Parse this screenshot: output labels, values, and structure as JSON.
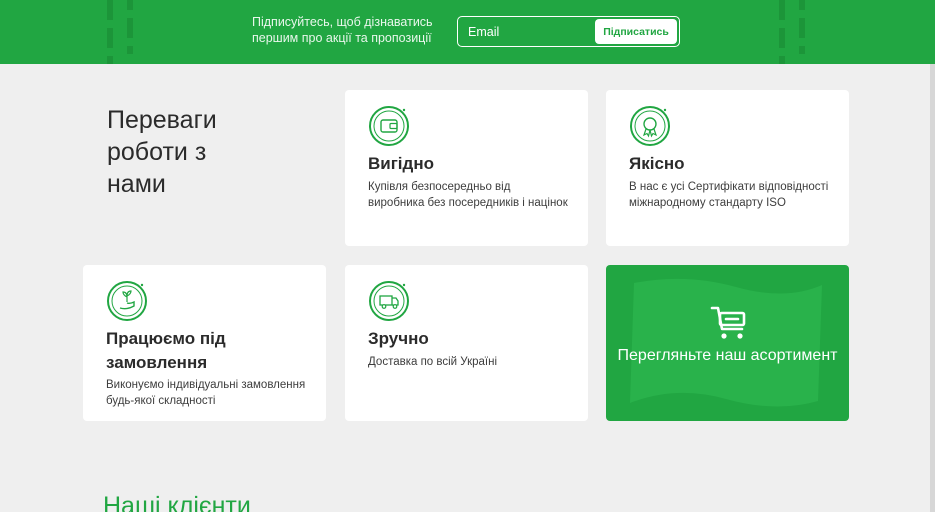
{
  "subscribe": {
    "text": "Підписуйтесь, щоб дізнаватись першим про акції та пропозиції",
    "email_placeholder": "Email",
    "button_label": "Підписатись"
  },
  "advantages": {
    "title": "Переваги роботи з нами",
    "cards": [
      {
        "title": "Вигідно",
        "description": "Купівля безпосередньо від виробника без посередників і націнок",
        "icon": "wallet-icon"
      },
      {
        "title": "Якісно",
        "description": "В нас є усі Сертифікати відповідності міжнародному стандарту ISO",
        "icon": "quality-badge-icon"
      },
      {
        "title": "Працюємо під замовлення",
        "description": "Виконуємо індивідуальні замовлення будь-якої складності",
        "icon": "hand-plant-icon"
      },
      {
        "title": "Зручно",
        "description": "Доставка по всій Україні",
        "icon": "delivery-truck-icon"
      }
    ],
    "cta": {
      "label": "Перегляньте наш асортимент",
      "icon": "cart-icon"
    }
  },
  "clients": {
    "title": "Наші клієнти"
  },
  "colors": {
    "brand_green": "#21a642",
    "card_bg": "#ffffff",
    "page_bg": "#efefef"
  }
}
